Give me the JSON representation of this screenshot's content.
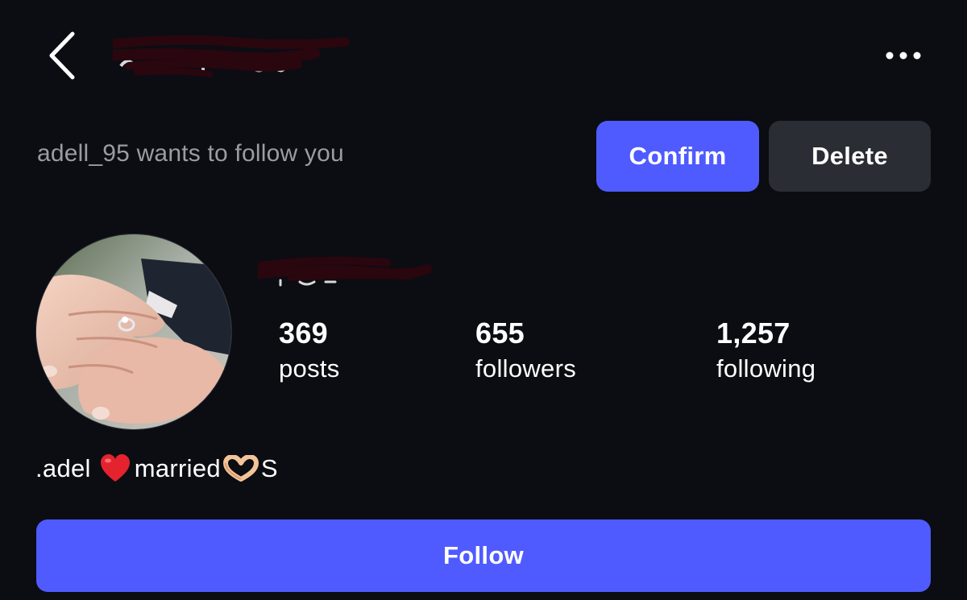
{
  "header": {
    "back_icon": "chevron-left-icon",
    "more_icon": "more-horizontal-icon"
  },
  "follow_request": {
    "text": "adell_95 wants to follow you",
    "confirm_label": "Confirm",
    "delete_label": "Delete"
  },
  "profile": {
    "stats": {
      "posts": {
        "value": "369",
        "label": "posts"
      },
      "followers": {
        "value": "655",
        "label": "followers"
      },
      "following": {
        "value": "1,257",
        "label": "following"
      }
    },
    "bio": {
      "prefix": ".adel",
      "middle": "married",
      "suffix": "S"
    }
  },
  "actions": {
    "follow_label": "Follow"
  },
  "colors": {
    "background": "#0b0d12",
    "accent": "#4f5bff",
    "secondary_button": "#2a2d33",
    "muted_text": "#9a9ca3",
    "redaction": "#2a060f"
  }
}
